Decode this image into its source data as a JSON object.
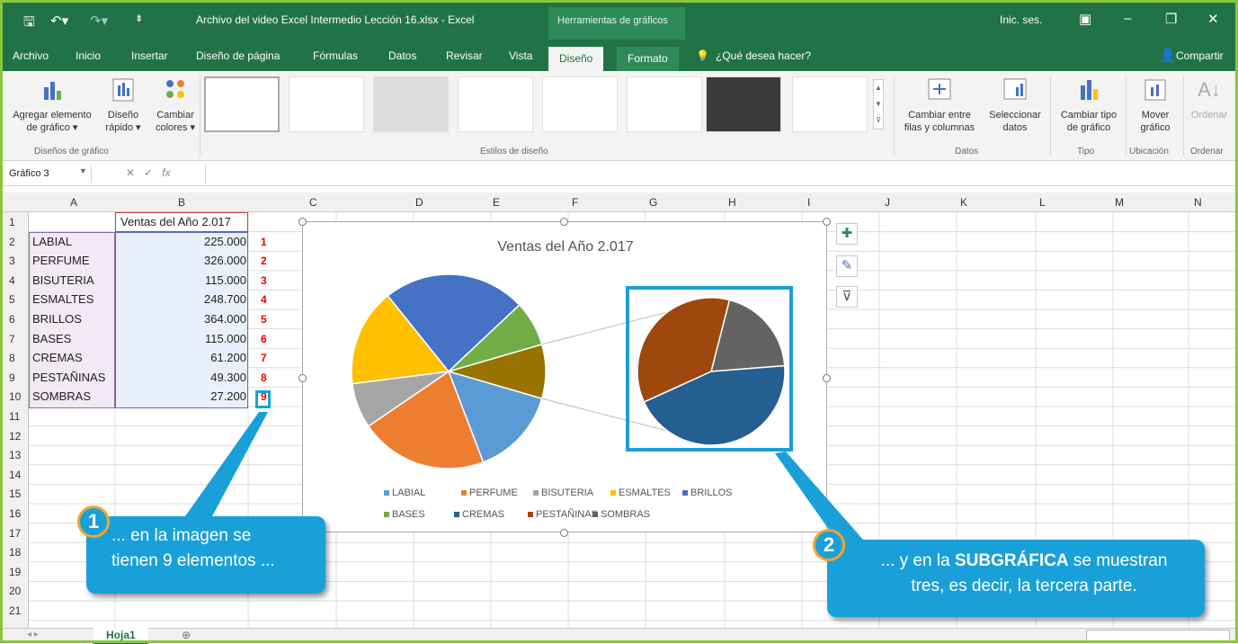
{
  "window": {
    "title": "Archivo del video Excel Intermedio Lección 16.xlsx  -  Excel",
    "context_tab": "Herramientas de gráficos",
    "signin": "Inic. ses."
  },
  "tabs": [
    "Archivo",
    "Inicio",
    "Insertar",
    "Diseño de página",
    "Fórmulas",
    "Datos",
    "Revisar",
    "Vista",
    "Diseño",
    "Formato"
  ],
  "tell_me": "¿Qué desea hacer?",
  "share": "Compartir",
  "ribbon": {
    "add_element": "Agregar elemento",
    "add_element2": "de gráfico ▾",
    "quick_layout": "Diseño",
    "quick_layout2": "rápido ▾",
    "change_colors": "Cambiar",
    "change_colors2": "colores ▾",
    "group_layouts": "Diseños de gráfico",
    "group_styles": "Estilos de diseño",
    "switch": "Cambiar entre",
    "switch2": "filas y columnas",
    "select_data": "Seleccionar",
    "select_data2": "datos",
    "group_data": "Datos",
    "change_type": "Cambiar tipo",
    "change_type2": "de gráfico",
    "group_type": "Tipo",
    "move": "Mover",
    "move2": "gráfico",
    "group_location": "Ubicación",
    "order": "Ordenar",
    "group_order": "Ordenar"
  },
  "namebox": "Gráfico 3",
  "columns": [
    "A",
    "B",
    "C",
    "D",
    "E",
    "F",
    "G",
    "H",
    "I",
    "J",
    "K",
    "L",
    "M",
    "N"
  ],
  "rows": [
    "1",
    "2",
    "3",
    "4",
    "5",
    "6",
    "7",
    "8",
    "9",
    "10",
    "11",
    "12",
    "13",
    "14",
    "15",
    "16",
    "17",
    "18",
    "19",
    "20",
    "21"
  ],
  "header_cell": "Ventas del Año 2.017",
  "table": [
    {
      "label": "LABIAL",
      "value": "225.000",
      "n": "1"
    },
    {
      "label": "PERFUME",
      "value": "326.000",
      "n": "2"
    },
    {
      "label": "BISUTERIA",
      "value": "115.000",
      "n": "3"
    },
    {
      "label": "ESMALTES",
      "value": "248.700",
      "n": "4"
    },
    {
      "label": "BRILLOS",
      "value": "364.000",
      "n": "5"
    },
    {
      "label": "BASES",
      "value": "115.000",
      "n": "6"
    },
    {
      "label": "CREMAS",
      "value": "61.200",
      "n": "7"
    },
    {
      "label": "PESTAÑINAS",
      "value": "49.300",
      "n": "8"
    },
    {
      "label": "SOMBRAS",
      "value": "27.200",
      "n": "9"
    }
  ],
  "chart_data": {
    "type": "pie",
    "subtype": "pie-of-pie",
    "title": "Ventas del Año 2.017",
    "categories": [
      "LABIAL",
      "PERFUME",
      "BISUTERIA",
      "ESMALTES",
      "BRILLOS",
      "BASES",
      "CREMAS",
      "PESTAÑINAS",
      "SOMBRAS"
    ],
    "values": [
      225000,
      326000,
      115000,
      248700,
      364000,
      115000,
      61200,
      49300,
      27200
    ],
    "secondary_plot_categories": [
      "CREMAS",
      "PESTAÑINAS",
      "SOMBRAS"
    ],
    "colors": [
      "#5b9bd5",
      "#ed7d31",
      "#a5a5a5",
      "#ffc000",
      "#4472c4",
      "#70ad47",
      "#255e91",
      "#9e480e",
      "#636363"
    ],
    "legend": "bottom"
  },
  "callout1": {
    "num": "1",
    "line1": "... en la imagen se",
    "line2": "tienen 9 elementos ..."
  },
  "callout2": {
    "num": "2",
    "pre": "... y en la ",
    "bold": "SUBGRÁFICA",
    "post": " se muestran",
    "line2": "tres, es decir, la tercera parte."
  },
  "sheet_tab": "Hoja1"
}
